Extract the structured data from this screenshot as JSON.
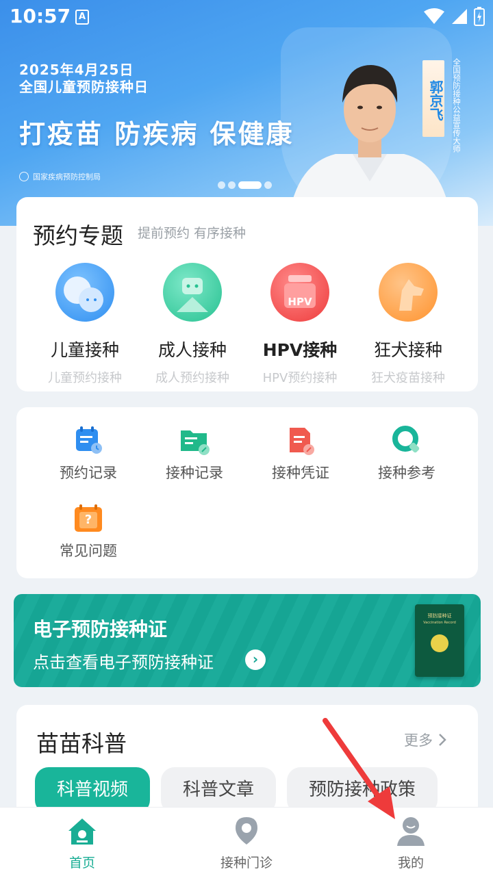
{
  "status_bar": {
    "time": "10:57",
    "app_glyph": "A"
  },
  "banner": {
    "date": "2025年4月25日",
    "event": "全国儿童预防接种日",
    "slogan": "打疫苗 防疾病 保健康",
    "agency": "国家疾病预防控制局",
    "ambassador_name": "郭京飞",
    "ambassador_title": "全国预防接种公益宣传大师",
    "dots_total": 4,
    "dots_active_index": 2
  },
  "topics": {
    "title": "预约专题",
    "subtitle": "提前预约 有序接种",
    "items": [
      {
        "label": "儿童接种",
        "sub": "儿童预约接种",
        "icon": "child-vaccination-icon"
      },
      {
        "label": "成人接种",
        "sub": "成人预约接种",
        "icon": "adult-vaccination-icon"
      },
      {
        "label": "HPV接种",
        "sub": "HPV预约接种",
        "icon": "hpv-vaccination-icon",
        "icon_text": "HPV"
      },
      {
        "label": "狂犬接种",
        "sub": "狂犬疫苗接种",
        "icon": "rabies-vaccination-icon"
      }
    ]
  },
  "tools": [
    {
      "label": "预约记录",
      "icon": "appointment-record-icon"
    },
    {
      "label": "接种记录",
      "icon": "vaccination-record-icon"
    },
    {
      "label": "接种凭证",
      "icon": "vaccination-certificate-icon"
    },
    {
      "label": "接种参考",
      "icon": "vaccination-reference-icon"
    },
    {
      "label": "常见问题",
      "icon": "faq-icon",
      "icon_text": "?"
    }
  ],
  "certificate": {
    "title": "电子预防接种证",
    "subtitle": "点击查看电子预防接种证",
    "book_title": "预防接种证",
    "book_subtitle": "Vaccination Record"
  },
  "science": {
    "title": "苗苗科普",
    "more": "更多",
    "tabs": [
      {
        "label": "科普视频",
        "active": true
      },
      {
        "label": "科普文章",
        "active": false
      },
      {
        "label": "预防接种政策",
        "active": false
      }
    ]
  },
  "bottom_nav": [
    {
      "label": "首页",
      "icon": "home-icon",
      "active": true
    },
    {
      "label": "接种门诊",
      "icon": "clinic-location-icon",
      "active": false
    },
    {
      "label": "我的",
      "icon": "profile-icon",
      "active": false
    }
  ],
  "colors": {
    "accent": "#19ad94",
    "banner_blue": "#3b8fea",
    "annotation_red": "#ee3b3b"
  }
}
